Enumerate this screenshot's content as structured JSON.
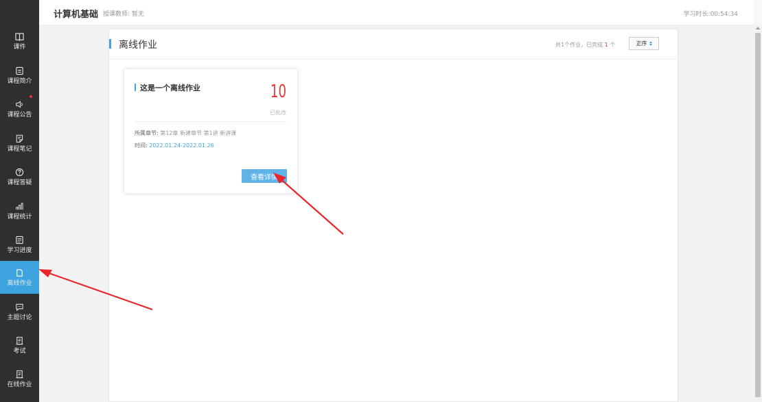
{
  "header": {
    "course_title": "计算机基础",
    "teacher": "授课教师: 暂无",
    "study_time": "学习时长:00:54:34"
  },
  "sidebar": {
    "items": [
      {
        "label": "课件",
        "icon": "book-icon"
      },
      {
        "label": "课程简介",
        "icon": "document-icon"
      },
      {
        "label": "课程公告",
        "icon": "speaker-icon"
      },
      {
        "label": "课程笔记",
        "icon": "note-icon"
      },
      {
        "label": "课程答疑",
        "icon": "question-icon"
      },
      {
        "label": "课程统计",
        "icon": "bar-chart-icon"
      },
      {
        "label": "学习进度",
        "icon": "progress-icon"
      },
      {
        "label": "离线作业",
        "icon": "file-icon"
      },
      {
        "label": "主题讨论",
        "icon": "chat-icon"
      },
      {
        "label": "考试",
        "icon": "exam-icon"
      },
      {
        "label": "在线作业",
        "icon": "exam-icon"
      }
    ],
    "active_index": 7
  },
  "panel": {
    "title": "离线作业",
    "summary_prefix": "共1个作业，已完成",
    "summary_count": "1",
    "summary_suffix": "个",
    "sort_label": "正序"
  },
  "assignment": {
    "title": "这是一个离线作业",
    "score": "10",
    "status": "已批改",
    "chapter_label": "所属章节:",
    "chapter_value": "第12章 新建章节 第1讲 新讲课",
    "time_label": "时间:",
    "time_value": "2022.01.24-2022.01.26",
    "detail_button": "查看详情"
  },
  "colors": {
    "accent": "#3ea4e0",
    "score": "#e53935",
    "sidebar_bg": "#2f2f2f",
    "annotation": "#e8262b"
  }
}
